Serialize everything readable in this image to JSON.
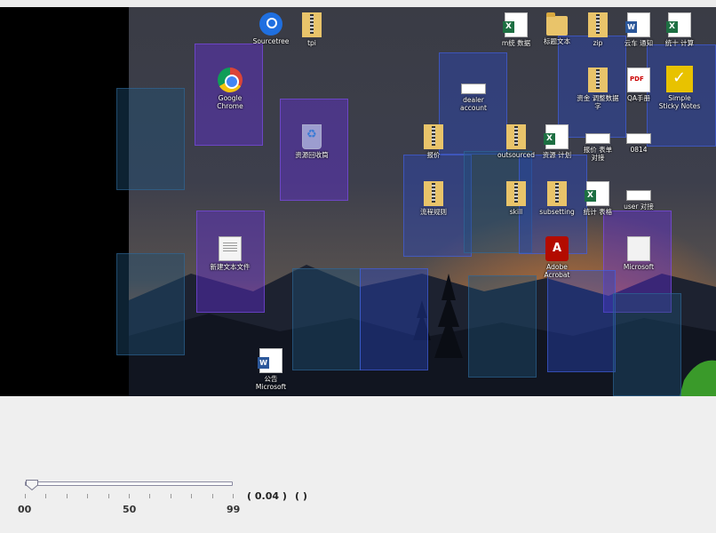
{
  "desktop_icons": {
    "sourcetree": "Sourcetree",
    "tpi": "tpi",
    "excel_1": "m统 数据",
    "folder_1": "标题文本",
    "zip_1": "zip",
    "word_1": "云车 通知",
    "excel_2": "统十 计算",
    "chrome": "Google\nChrome",
    "recycle_bin": "资源回收筒",
    "dealer_account": "dealer\naccount",
    "zip_2": "资金 调整数据\n字",
    "pdf_1": "QA手册",
    "sticky_notes": "Simple\nSticky Notes",
    "zip_3": "报价",
    "folder_2": "outsourced",
    "excel_3": "资源 计划",
    "wide_1": "报价 表单\n对接",
    "wide_2": "0814",
    "zip_4": "流程规则",
    "zip_5": "skill",
    "zip_6": "subsetting",
    "excel_4": "统计 表格",
    "wide_3": "user 对接",
    "text_file": "新建文本文件",
    "acrobat": "Adobe\nAcrobat",
    "ms_comp": "Microsoft",
    "word_2": "公告\nMicrosoft"
  },
  "slider": {
    "min_label": "00",
    "mid_label": "50",
    "max_label": "99",
    "value": 0.04,
    "readout": "( 0.04 )",
    "readout_2": "(        )"
  },
  "colors": {
    "overlay_purple": "#642ddc",
    "overlay_blue": "#2846be",
    "overlay_teal": "#1e5078",
    "panel_bg": "#efefef"
  }
}
